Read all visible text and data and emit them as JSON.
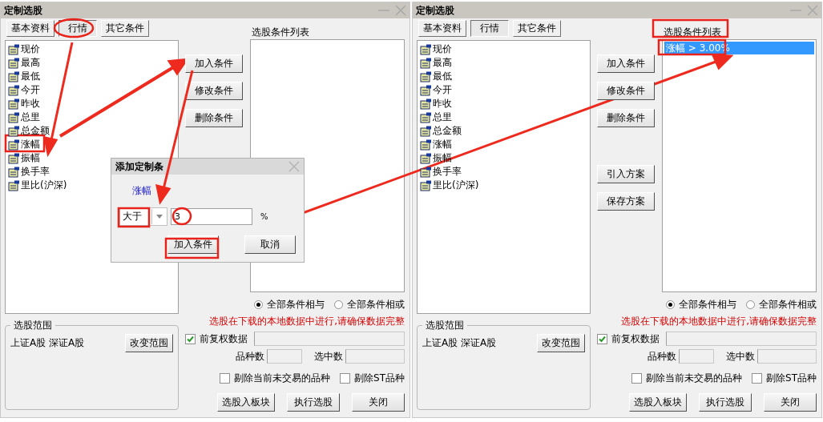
{
  "windows": [
    {
      "title": "定制选股",
      "tabs": [
        {
          "label": "基本资料",
          "selected": false
        },
        {
          "label": "行情",
          "selected": true
        },
        {
          "label": "其它条件",
          "selected": false
        }
      ],
      "fields": [
        {
          "label": "现价",
          "selected": false
        },
        {
          "label": "最高",
          "selected": false
        },
        {
          "label": "最低",
          "selected": false
        },
        {
          "label": "今开",
          "selected": false
        },
        {
          "label": "昨收",
          "selected": false
        },
        {
          "label": "总里",
          "selected": false
        },
        {
          "label": "总金额",
          "selected": false
        },
        {
          "label": "涨幅",
          "selected": false
        },
        {
          "label": "振幅",
          "selected": false
        },
        {
          "label": "换手率",
          "selected": false
        },
        {
          "label": "里比(沪深)",
          "selected": false
        }
      ],
      "buttons": [
        "加入条件",
        "修改条件",
        "删除条件"
      ],
      "list_heading": "选股条件列表",
      "logic": [
        {
          "label": "全部条件相与",
          "selected": true
        },
        {
          "label": "全部条件相或",
          "selected": false
        }
      ],
      "notice": "选股在下载的本地数据中进行,请确保数据完整",
      "adjust": {
        "label": "前复权数据",
        "checked": true
      },
      "counts": [
        "品种数",
        "选中数"
      ],
      "exclude": [
        {
          "label": "剔除当前未交易的品种",
          "checked": false
        },
        {
          "label": "剔除ST品种",
          "checked": false
        }
      ],
      "actions": [
        "选股入板块",
        "执行选股",
        "关闭"
      ],
      "scope": {
        "title": "选股范围",
        "text": "上证A股 深证A股",
        "button": "改变范围"
      }
    },
    {
      "title": "定制选股",
      "tabs": [
        {
          "label": "基本资料",
          "selected": false
        },
        {
          "label": "行情",
          "selected": true
        },
        {
          "label": "其它条件",
          "selected": false
        }
      ],
      "fields": [
        {
          "label": "现价",
          "selected": false
        },
        {
          "label": "最高",
          "selected": false
        },
        {
          "label": "最低",
          "selected": false
        },
        {
          "label": "今开",
          "selected": false
        },
        {
          "label": "昨收",
          "selected": false
        },
        {
          "label": "总里",
          "selected": false
        },
        {
          "label": "总金额",
          "selected": false
        },
        {
          "label": "涨幅",
          "selected": false
        },
        {
          "label": "振幅",
          "selected": false
        },
        {
          "label": "换手率",
          "selected": false
        },
        {
          "label": "里比(沪深)",
          "selected": false
        }
      ],
      "buttons": [
        "加入条件",
        "修改条件",
        "删除条件",
        "引入方案",
        "保存方案"
      ],
      "list_heading": "选股条件列表",
      "conditions": [
        {
          "text": "涨幅 > 3.00%",
          "selected": true
        }
      ],
      "logic": [
        {
          "label": "全部条件相与",
          "selected": true
        },
        {
          "label": "全部条件相或",
          "selected": false
        }
      ],
      "notice": "选股在下载的本地数据中进行,请确保数据完整",
      "adjust": {
        "label": "前复权数据",
        "checked": true
      },
      "counts": [
        "品种数",
        "选中数"
      ],
      "exclude": [
        {
          "label": "剔除当前未交易的品种",
          "checked": false
        },
        {
          "label": "剔除ST品种",
          "checked": false
        }
      ],
      "actions": [
        "选股入板块",
        "执行选股",
        "关闭"
      ],
      "scope": {
        "title": "选股范围",
        "text": "上证A股 深证A股",
        "button": "改变范围"
      }
    }
  ],
  "dialog": {
    "title": "添加定制条",
    "field_label": "涨幅",
    "operator": "大于",
    "amount": "3",
    "unit": "%",
    "buttons": [
      "加入条件",
      "取消"
    ]
  }
}
